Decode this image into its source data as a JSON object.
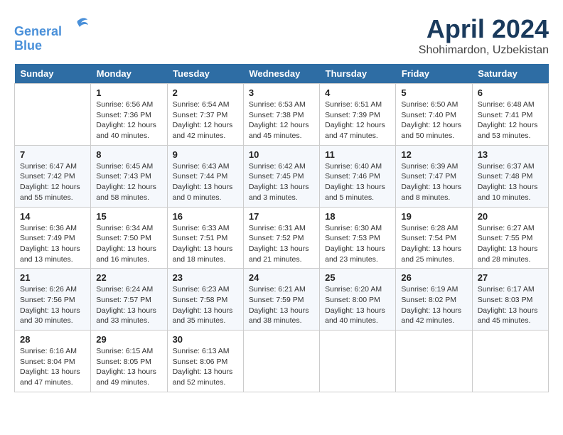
{
  "header": {
    "logo_line1": "General",
    "logo_line2": "Blue",
    "month": "April 2024",
    "location": "Shohimardon, Uzbekistan"
  },
  "weekdays": [
    "Sunday",
    "Monday",
    "Tuesday",
    "Wednesday",
    "Thursday",
    "Friday",
    "Saturday"
  ],
  "weeks": [
    [
      {
        "day": "",
        "info": ""
      },
      {
        "day": "1",
        "info": "Sunrise: 6:56 AM\nSunset: 7:36 PM\nDaylight: 12 hours\nand 40 minutes."
      },
      {
        "day": "2",
        "info": "Sunrise: 6:54 AM\nSunset: 7:37 PM\nDaylight: 12 hours\nand 42 minutes."
      },
      {
        "day": "3",
        "info": "Sunrise: 6:53 AM\nSunset: 7:38 PM\nDaylight: 12 hours\nand 45 minutes."
      },
      {
        "day": "4",
        "info": "Sunrise: 6:51 AM\nSunset: 7:39 PM\nDaylight: 12 hours\nand 47 minutes."
      },
      {
        "day": "5",
        "info": "Sunrise: 6:50 AM\nSunset: 7:40 PM\nDaylight: 12 hours\nand 50 minutes."
      },
      {
        "day": "6",
        "info": "Sunrise: 6:48 AM\nSunset: 7:41 PM\nDaylight: 12 hours\nand 53 minutes."
      }
    ],
    [
      {
        "day": "7",
        "info": "Sunrise: 6:47 AM\nSunset: 7:42 PM\nDaylight: 12 hours\nand 55 minutes."
      },
      {
        "day": "8",
        "info": "Sunrise: 6:45 AM\nSunset: 7:43 PM\nDaylight: 12 hours\nand 58 minutes."
      },
      {
        "day": "9",
        "info": "Sunrise: 6:43 AM\nSunset: 7:44 PM\nDaylight: 13 hours\nand 0 minutes."
      },
      {
        "day": "10",
        "info": "Sunrise: 6:42 AM\nSunset: 7:45 PM\nDaylight: 13 hours\nand 3 minutes."
      },
      {
        "day": "11",
        "info": "Sunrise: 6:40 AM\nSunset: 7:46 PM\nDaylight: 13 hours\nand 5 minutes."
      },
      {
        "day": "12",
        "info": "Sunrise: 6:39 AM\nSunset: 7:47 PM\nDaylight: 13 hours\nand 8 minutes."
      },
      {
        "day": "13",
        "info": "Sunrise: 6:37 AM\nSunset: 7:48 PM\nDaylight: 13 hours\nand 10 minutes."
      }
    ],
    [
      {
        "day": "14",
        "info": "Sunrise: 6:36 AM\nSunset: 7:49 PM\nDaylight: 13 hours\nand 13 minutes."
      },
      {
        "day": "15",
        "info": "Sunrise: 6:34 AM\nSunset: 7:50 PM\nDaylight: 13 hours\nand 16 minutes."
      },
      {
        "day": "16",
        "info": "Sunrise: 6:33 AM\nSunset: 7:51 PM\nDaylight: 13 hours\nand 18 minutes."
      },
      {
        "day": "17",
        "info": "Sunrise: 6:31 AM\nSunset: 7:52 PM\nDaylight: 13 hours\nand 21 minutes."
      },
      {
        "day": "18",
        "info": "Sunrise: 6:30 AM\nSunset: 7:53 PM\nDaylight: 13 hours\nand 23 minutes."
      },
      {
        "day": "19",
        "info": "Sunrise: 6:28 AM\nSunset: 7:54 PM\nDaylight: 13 hours\nand 25 minutes."
      },
      {
        "day": "20",
        "info": "Sunrise: 6:27 AM\nSunset: 7:55 PM\nDaylight: 13 hours\nand 28 minutes."
      }
    ],
    [
      {
        "day": "21",
        "info": "Sunrise: 6:26 AM\nSunset: 7:56 PM\nDaylight: 13 hours\nand 30 minutes."
      },
      {
        "day": "22",
        "info": "Sunrise: 6:24 AM\nSunset: 7:57 PM\nDaylight: 13 hours\nand 33 minutes."
      },
      {
        "day": "23",
        "info": "Sunrise: 6:23 AM\nSunset: 7:58 PM\nDaylight: 13 hours\nand 35 minutes."
      },
      {
        "day": "24",
        "info": "Sunrise: 6:21 AM\nSunset: 7:59 PM\nDaylight: 13 hours\nand 38 minutes."
      },
      {
        "day": "25",
        "info": "Sunrise: 6:20 AM\nSunset: 8:00 PM\nDaylight: 13 hours\nand 40 minutes."
      },
      {
        "day": "26",
        "info": "Sunrise: 6:19 AM\nSunset: 8:02 PM\nDaylight: 13 hours\nand 42 minutes."
      },
      {
        "day": "27",
        "info": "Sunrise: 6:17 AM\nSunset: 8:03 PM\nDaylight: 13 hours\nand 45 minutes."
      }
    ],
    [
      {
        "day": "28",
        "info": "Sunrise: 6:16 AM\nSunset: 8:04 PM\nDaylight: 13 hours\nand 47 minutes."
      },
      {
        "day": "29",
        "info": "Sunrise: 6:15 AM\nSunset: 8:05 PM\nDaylight: 13 hours\nand 49 minutes."
      },
      {
        "day": "30",
        "info": "Sunrise: 6:13 AM\nSunset: 8:06 PM\nDaylight: 13 hours\nand 52 minutes."
      },
      {
        "day": "",
        "info": ""
      },
      {
        "day": "",
        "info": ""
      },
      {
        "day": "",
        "info": ""
      },
      {
        "day": "",
        "info": ""
      }
    ]
  ]
}
